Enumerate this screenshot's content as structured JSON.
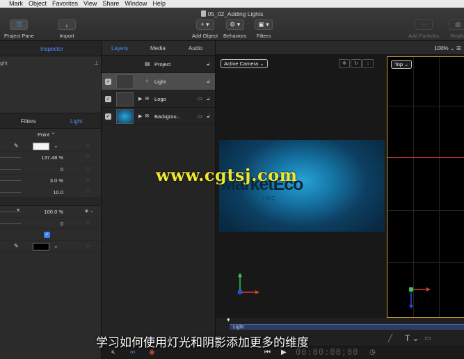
{
  "menubar": [
    "Mark",
    "Object",
    "Favorites",
    "View",
    "Share",
    "Window",
    "Help"
  ],
  "document_title": "05_02_Adding Lights",
  "toolbar": {
    "project_pane": "Project Pane",
    "import": "Import",
    "add_object": "Add Object",
    "behaviors": "Behaviors",
    "filters": "Filters",
    "add_particles": "Add Particles",
    "replicate": "Replic"
  },
  "inspector": {
    "title": "Inspector",
    "preview_name": "ght",
    "tabs": {
      "filters": "Filters",
      "light": "Light"
    },
    "light_type": "Point",
    "values": {
      "intensity": "137.48 %",
      "falloff": "0",
      "falloff_start": "3.0 %",
      "attenuation": "10.0"
    },
    "shadow_values": {
      "opacity": "100.0 %",
      "softness": "0"
    }
  },
  "layers_panel": {
    "tabs": [
      "Layers",
      "Media",
      "Audio"
    ],
    "rows": [
      {
        "name": "Project"
      },
      {
        "name": "Light"
      },
      {
        "name": "Logo"
      },
      {
        "name": "Backgrou..."
      }
    ]
  },
  "canvas": {
    "zoom": "100%",
    "active_camera": "Active Camera",
    "top_view": "Top",
    "logo_text": "MarketEco",
    "logo_sub": "INC",
    "watermark": "www.cgtsj.com"
  },
  "timeline": {
    "layer_label": "Light",
    "timecode": "00:00:00;00"
  },
  "subtitle": "学习如何使用灯光和阴影添加更多的维度"
}
